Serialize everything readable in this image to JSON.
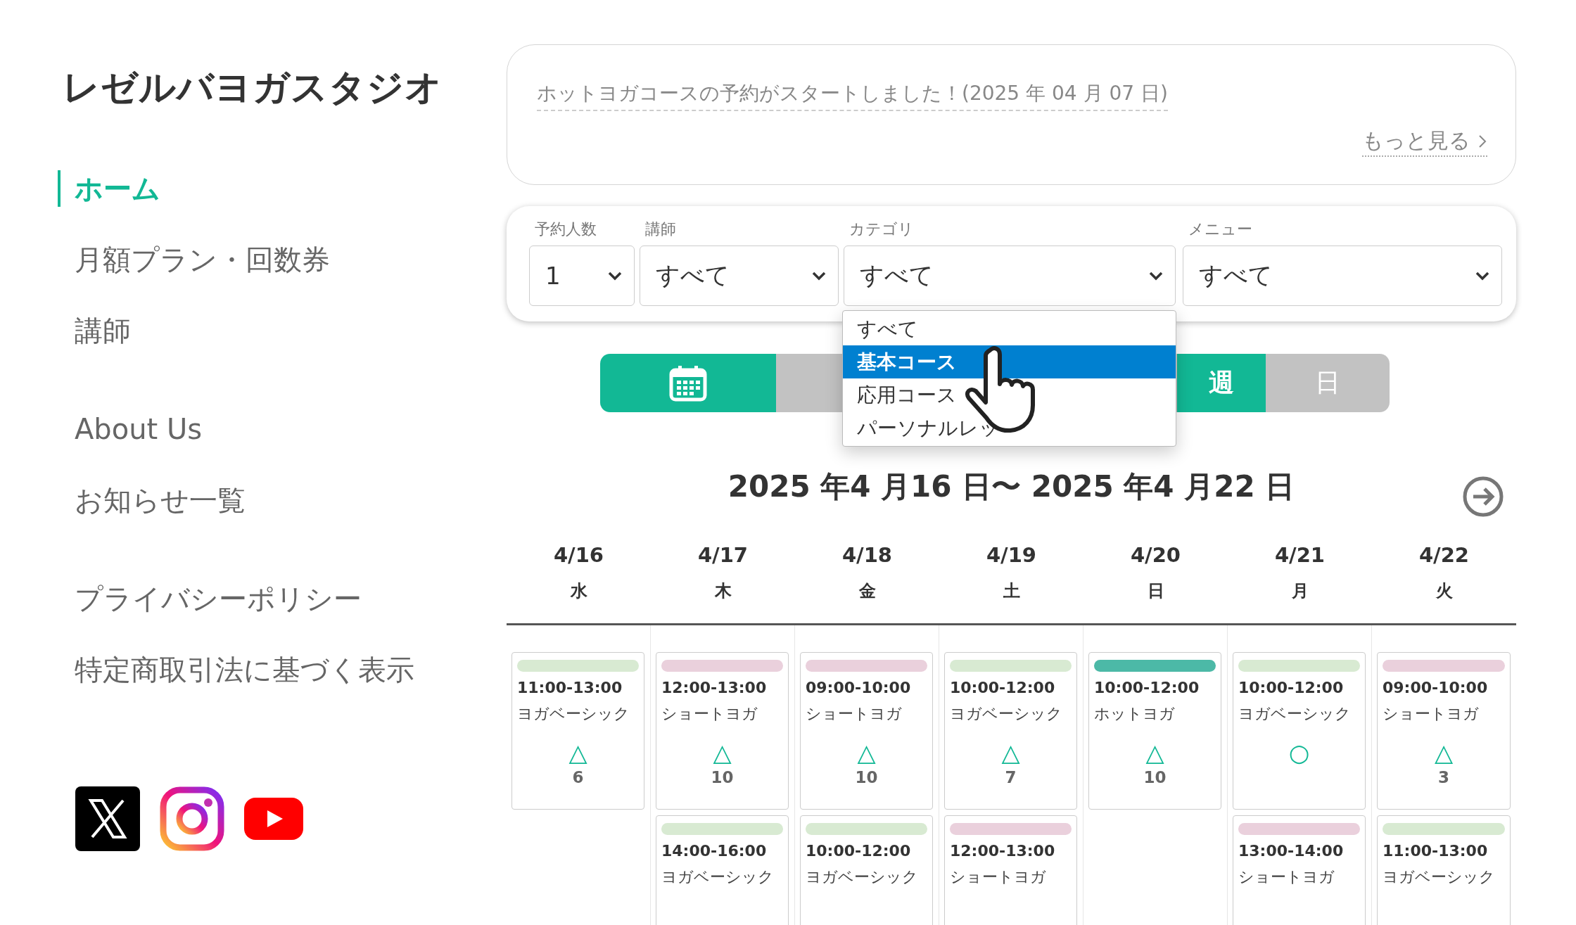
{
  "sidebar": {
    "logo": "レゼルバヨガスタジオ",
    "nav_groups": [
      [
        {
          "label": "ホーム",
          "selected": true
        },
        {
          "label": "月額プラン・回数券",
          "selected": false
        },
        {
          "label": "講師",
          "selected": false
        }
      ],
      [
        {
          "label": "About Us",
          "selected": false
        },
        {
          "label": "お知らせ一覧",
          "selected": false
        }
      ],
      [
        {
          "label": "プライバシーポリシー",
          "selected": false
        },
        {
          "label": "特定商取引法に基づく表示",
          "selected": false
        }
      ]
    ],
    "social": [
      {
        "kind": "x"
      },
      {
        "kind": "instagram"
      },
      {
        "kind": "youtube"
      }
    ]
  },
  "notice": {
    "text": "ホットヨガコースの予約がスタートしました！(2025 年 04 月 07 日)",
    "more": "もっと見る"
  },
  "filters": [
    {
      "label": "予約人数",
      "value": "1"
    },
    {
      "label": "講師",
      "value": "すべて"
    },
    {
      "label": "カテゴリ",
      "value": "すべて"
    },
    {
      "label": "メニュー",
      "value": "すべて"
    }
  ],
  "dropdown": {
    "options": [
      {
        "label": "すべて",
        "selected": false
      },
      {
        "label": "基本コース",
        "selected": true
      },
      {
        "label": "応用コース",
        "selected": false
      },
      {
        "label": "パーソナルレッ",
        "selected": false
      }
    ]
  },
  "view_tabs": [
    {
      "label": "週",
      "selected": true
    },
    {
      "label": "日",
      "selected": false
    }
  ],
  "range": "2025 年4 月16 日〜 2025 年4 月22 日",
  "days": [
    {
      "date": "4/16",
      "weekday": "水",
      "sessions": [
        {
          "time": "11:00-13:00",
          "name": "ヨガベーシック",
          "color": "#d8ead2",
          "symbol": "△",
          "count": "6"
        }
      ]
    },
    {
      "date": "4/17",
      "weekday": "木",
      "sessions": [
        {
          "time": "12:00-13:00",
          "name": "ショートヨガ",
          "color": "#ead0dc",
          "symbol": "△",
          "count": "10"
        },
        {
          "time": "14:00-16:00",
          "name": "ヨガベーシック",
          "color": "#d8ead2"
        }
      ]
    },
    {
      "date": "4/18",
      "weekday": "金",
      "sessions": [
        {
          "time": "09:00-10:00",
          "name": "ショートヨガ",
          "color": "#ead0dc",
          "symbol": "△",
          "count": "10"
        },
        {
          "time": "10:00-12:00",
          "name": "ヨガベーシック",
          "color": "#d8ead2"
        }
      ]
    },
    {
      "date": "4/19",
      "weekday": "土",
      "sessions": [
        {
          "time": "10:00-12:00",
          "name": "ヨガベーシック",
          "color": "#d8ead2",
          "symbol": "△",
          "count": "7"
        },
        {
          "time": "12:00-13:00",
          "name": "ショートヨガ",
          "color": "#ead0dc"
        }
      ]
    },
    {
      "date": "4/20",
      "weekday": "日",
      "sessions": [
        {
          "time": "10:00-12:00",
          "name": "ホットヨガ",
          "color": "#4cb9a7",
          "symbol": "△",
          "count": "10"
        }
      ]
    },
    {
      "date": "4/21",
      "weekday": "月",
      "sessions": [
        {
          "time": "10:00-12:00",
          "name": "ヨガベーシック",
          "color": "#d8ead2",
          "symbol": "○"
        },
        {
          "time": "13:00-14:00",
          "name": "ショートヨガ",
          "color": "#ead0dc"
        }
      ]
    },
    {
      "date": "4/22",
      "weekday": "火",
      "sessions": [
        {
          "time": "09:00-10:00",
          "name": "ショートヨガ",
          "color": "#ead0dc",
          "symbol": "△",
          "count": "3"
        },
        {
          "time": "11:00-13:00",
          "name": "ヨガベーシック",
          "color": "#d8ead2"
        }
      ]
    }
  ]
}
